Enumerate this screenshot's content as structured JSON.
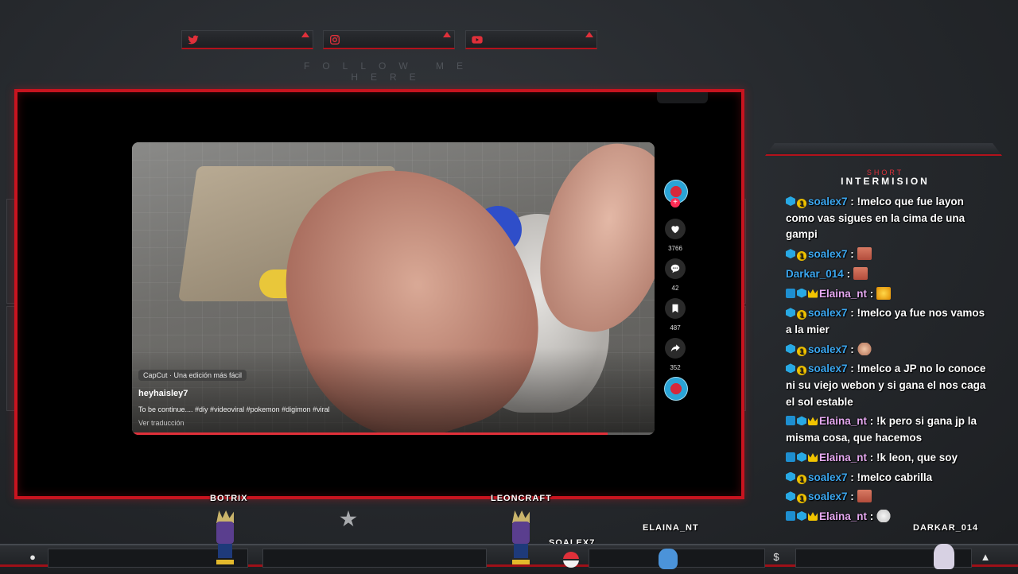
{
  "overlay": {
    "follow_text": "FOLLOW ME HERE",
    "social": [
      {
        "icon": "twitter-icon"
      },
      {
        "icon": "instagram-icon"
      },
      {
        "icon": "youtube-icon"
      }
    ]
  },
  "video": {
    "capcut_label": "CapCut · Una edición más fácil",
    "username": "heyhaisley7",
    "description": "To be continue.... #diy #videoviral #pokemon #digimon #viral",
    "translate": "Ver traducción",
    "progress": 0.91,
    "likes": "3766",
    "comments": "42",
    "saves": "487",
    "shares": "352"
  },
  "chat": {
    "header_small": "SHORT",
    "header_title": "INTERMISION",
    "messages": [
      {
        "user": "soalex7",
        "user_color": "#3ba7f0",
        "badges": [
          "cyan",
          "gold"
        ],
        "text": " : !melco que fue layon como vas sigues en la cima de una gampi",
        "emote": ""
      },
      {
        "user": "soalex7",
        "user_color": "#3ba7f0",
        "badges": [
          "cyan",
          "gold"
        ],
        "text": " : ",
        "emote": "face"
      },
      {
        "user": "Darkar_014",
        "user_color": "#3ba7f0",
        "badges": [],
        "text": " : ",
        "emote": "face"
      },
      {
        "user": "Elaina_nt",
        "user_color": "#e6a9f1",
        "badges": [
          "wave",
          "cyan",
          "crown"
        ],
        "text": " : ",
        "emote": "gold"
      },
      {
        "user": "soalex7",
        "user_color": "#3ba7f0",
        "badges": [
          "cyan",
          "gold"
        ],
        "text": " : !melco ya fue nos vamos a la mier",
        "emote": ""
      },
      {
        "user": "soalex7",
        "user_color": "#3ba7f0",
        "badges": [
          "cyan",
          "gold"
        ],
        "text": " : ",
        "emote": "arm"
      },
      {
        "user": "soalex7",
        "user_color": "#3ba7f0",
        "badges": [
          "cyan",
          "gold"
        ],
        "text": " : !melco a JP no lo conoce ni su viejo webon y si gana el nos caga el sol estable",
        "emote": ""
      },
      {
        "user": "Elaina_nt",
        "user_color": "#e6a9f1",
        "badges": [
          "wave",
          "cyan",
          "crown"
        ],
        "text": " : !k pero si gana jp la misma cosa, que hacemos",
        "emote": ""
      },
      {
        "user": "Elaina_nt",
        "user_color": "#e6a9f1",
        "badges": [
          "wave",
          "cyan",
          "crown"
        ],
        "text": " : !k leon, que soy",
        "emote": ""
      },
      {
        "user": "soalex7",
        "user_color": "#3ba7f0",
        "badges": [
          "cyan",
          "gold"
        ],
        "text": " : !melco cabrilla",
        "emote": ""
      },
      {
        "user": "soalex7",
        "user_color": "#3ba7f0",
        "badges": [
          "cyan",
          "gold"
        ],
        "text": " : ",
        "emote": "face"
      },
      {
        "user": "Elaina_nt",
        "user_color": "#e6a9f1",
        "badges": [
          "wave",
          "cyan",
          "crown"
        ],
        "text": " : ",
        "emote": "duck"
      }
    ]
  },
  "viewers": {
    "botrix": "BOTRIX",
    "leoncraft": "LEONCRAFT",
    "soalex7": "SOALEX7",
    "elaina": "ELAINA_NT",
    "darkar": "DARKAR_014"
  },
  "bottom_icons": [
    "user-icon",
    "dollar-icon",
    "flame-icon"
  ]
}
